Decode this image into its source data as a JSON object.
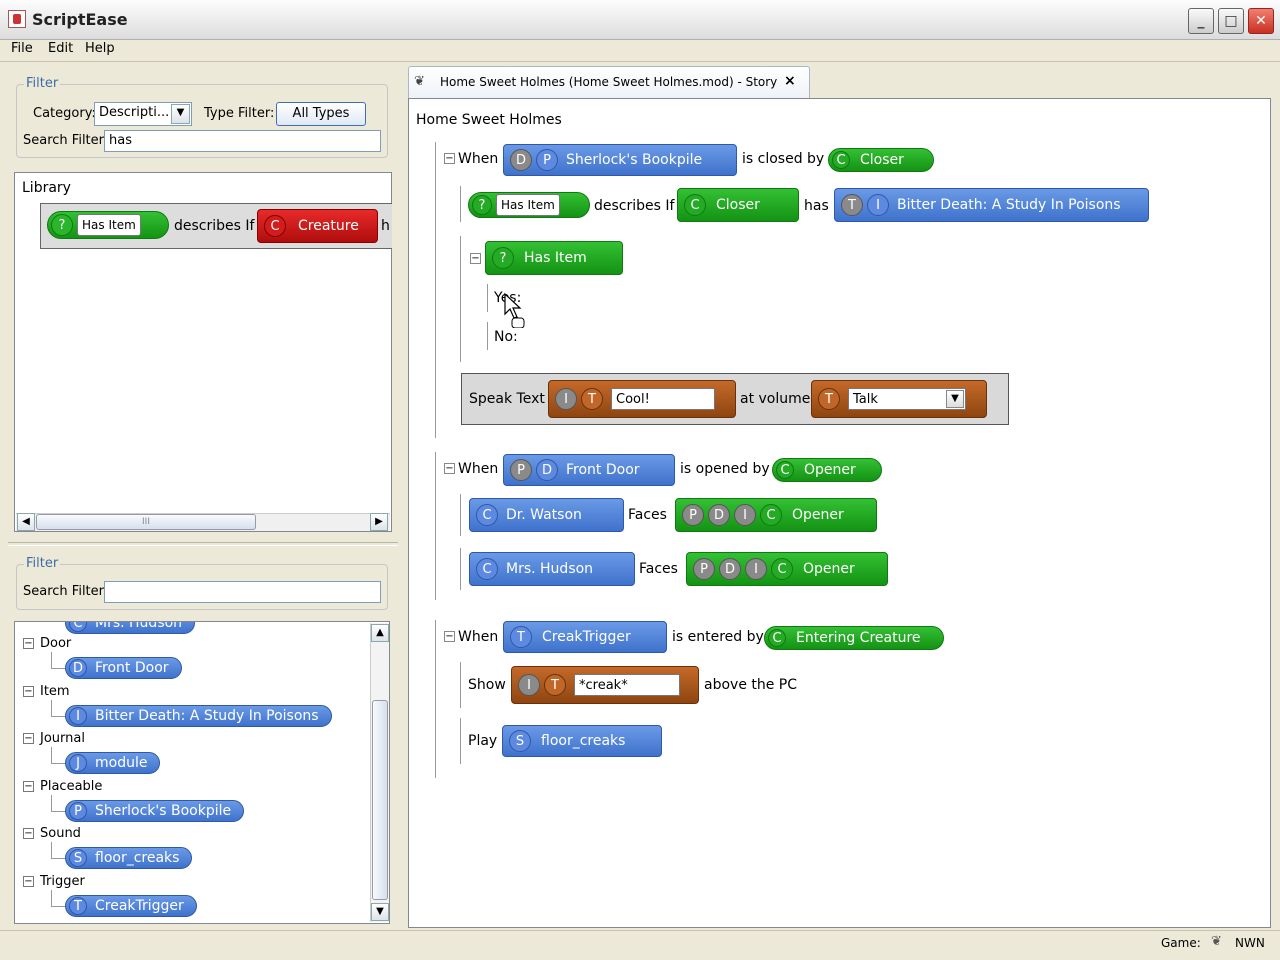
{
  "window": {
    "title": "ScriptEase",
    "controls": [
      "_",
      "□",
      "✕"
    ]
  },
  "menu": [
    "File",
    "Edit",
    "Help"
  ],
  "filter_top": {
    "legend": "Filter",
    "category_label": "Category:",
    "category_value": "Descripti...",
    "type_filter_label": "Type Filter:",
    "type_filter_button": "All Types",
    "search_label": "Search Filter:",
    "search_value": "has"
  },
  "library": {
    "title": "Library",
    "entry": {
      "badge": "?",
      "field": "Has Item",
      "text": "describes If",
      "c_badge": "C",
      "c_label": "Creature",
      "cut": "h"
    },
    "scroll_grip": "III"
  },
  "filter_bottom": {
    "legend": "Filter",
    "search_label": "Search Filter:",
    "search_value": ""
  },
  "tree": {
    "cut_top": "Mrs. Hudson",
    "groups": [
      {
        "label": "Door",
        "badge": "D",
        "item": "Front Door"
      },
      {
        "label": "Item",
        "badge": "I",
        "item": "Bitter Death: A Study In Poisons"
      },
      {
        "label": "Journal",
        "badge": "J",
        "item": "module"
      },
      {
        "label": "Placeable",
        "badge": "P",
        "item": "Sherlock's Bookpile"
      },
      {
        "label": "Sound",
        "badge": "S",
        "item": "floor_creaks"
      },
      {
        "label": "Trigger",
        "badge": "T",
        "item": "CreakTrigger"
      }
    ]
  },
  "tab": {
    "title": "Home Sweet Holmes (Home Sweet Holmes.mod) - Story",
    "close": "×"
  },
  "story": {
    "name": "Home Sweet Holmes",
    "when1": {
      "when": "When",
      "b1": "D",
      "b2": "P",
      "subject": "Sherlock's Bookpile",
      "verb": "is closed by",
      "cb": "C",
      "obj": "Closer",
      "desc": {
        "badge": "?",
        "field": "Has Item",
        "text": "describes If",
        "cb": "C",
        "obj": "Closer",
        "has": "has",
        "t": "T",
        "i": "I",
        "item": "Bitter Death: A Study In Poisons"
      },
      "if": {
        "badge": "?",
        "label": "Has Item",
        "yes": "Yes:",
        "no": "No:"
      },
      "speak": {
        "label": "Speak Text",
        "i": "I",
        "t": "T",
        "text": "Cool!",
        "at": "at volume",
        "vt": "T",
        "volume": "Talk"
      }
    },
    "when2": {
      "when": "When",
      "b1": "P",
      "b2": "D",
      "subject": "Front Door",
      "verb": "is opened by",
      "cb": "C",
      "obj": "Opener",
      "face1": {
        "cb": "C",
        "who": "Dr. Watson",
        "faces": "Faces",
        "p": "P",
        "d": "D",
        "i": "I",
        "c": "C",
        "obj": "Opener"
      },
      "face2": {
        "cb": "C",
        "who": "Mrs. Hudson",
        "faces": "Faces",
        "p": "P",
        "d": "D",
        "i": "I",
        "c": "C",
        "obj": "Opener"
      }
    },
    "when3": {
      "when": "When",
      "tb": "T",
      "subject": "CreakTrigger",
      "verb": "is entered by",
      "cb": "C",
      "obj": "Entering Creature",
      "show": {
        "label": "Show",
        "i": "I",
        "t": "T",
        "text": "*creak*",
        "after": "above the PC"
      },
      "play": {
        "label": "Play",
        "sb": "S",
        "sound": "floor_creaks"
      }
    }
  },
  "status": {
    "game_label": "Game:",
    "game_value": "NWN"
  }
}
